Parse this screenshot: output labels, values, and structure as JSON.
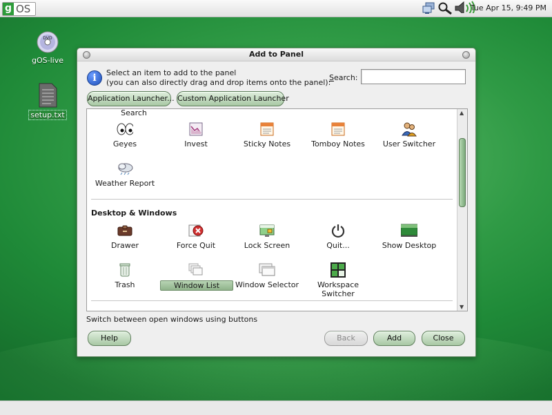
{
  "panel": {
    "logo_g": "g",
    "logo_os": "OS",
    "clock": "Tue Apr 15,  9:49 PM"
  },
  "desktop_icons": [
    {
      "label": "gOS-live"
    },
    {
      "label": "setup.txt"
    }
  ],
  "dialog": {
    "title": "Add to Panel",
    "instruction_line1": "Select an item to add to the panel",
    "instruction_line2": "(you can also directly drag and drop items onto the panel):",
    "search_label": "Search:",
    "search_value": "",
    "launcher_buttons": [
      "Application Launcher...",
      "Custom Application Launcher"
    ],
    "partial_item": "Search",
    "row1": [
      {
        "label": "Geyes",
        "icon": "eyes-icon"
      },
      {
        "label": "Invest",
        "icon": "chart-icon"
      },
      {
        "label": "Sticky Notes",
        "icon": "notes-icon"
      },
      {
        "label": "Tomboy Notes",
        "icon": "notes-icon"
      },
      {
        "label": "User Switcher",
        "icon": "users-icon"
      }
    ],
    "row2": [
      {
        "label": "Weather Report",
        "icon": "weather-icon"
      }
    ],
    "section": "Desktop & Windows",
    "row3": [
      {
        "label": "Drawer",
        "icon": "drawer-icon"
      },
      {
        "label": "Force Quit",
        "icon": "force-quit-icon"
      },
      {
        "label": "Lock Screen",
        "icon": "lock-screen-icon"
      },
      {
        "label": "Quit...",
        "icon": "power-icon"
      },
      {
        "label": "Show Desktop",
        "icon": "show-desktop-icon"
      }
    ],
    "row4": [
      {
        "label": "Trash",
        "icon": "trash-icon"
      },
      {
        "label": "Window List",
        "icon": "window-list-icon",
        "selected": true
      },
      {
        "label": "Window Selector",
        "icon": "window-selector-icon"
      },
      {
        "label": "Workspace Switcher",
        "icon": "workspace-switcher-icon"
      }
    ],
    "status": "Switch between open windows using buttons",
    "buttons": {
      "help": "Help",
      "back": "Back",
      "add": "Add",
      "close": "Close"
    }
  },
  "colors": {
    "accent": "#2d9b3a",
    "selection": "#a3c49e"
  }
}
